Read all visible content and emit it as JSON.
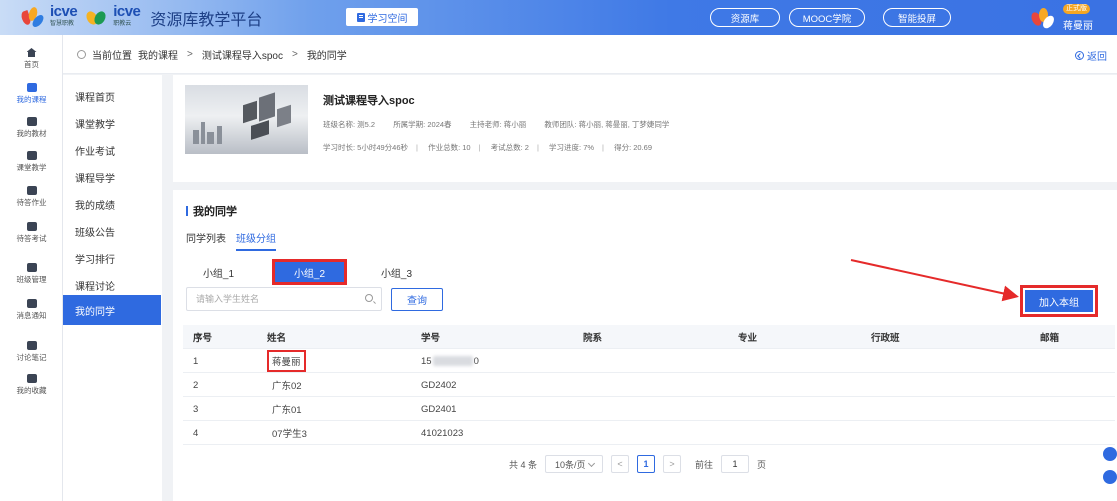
{
  "topbar": {
    "logo1_text": "icve",
    "logo1_sub": "智慧职教",
    "logo2_text": "icve",
    "logo2_sub": "职教云",
    "platform_title": "资源库教学平台",
    "study_space": "学习空间",
    "nav": [
      "资源库",
      "MOOC学院",
      "智能投屏"
    ],
    "user_badge": "正式版",
    "user_name": "蒋曼丽"
  },
  "rail": [
    {
      "label": "首页",
      "icon": "home-icon"
    },
    {
      "label": "我的课程",
      "icon": "course-icon",
      "active": true
    },
    {
      "label": "我的教材",
      "icon": "textbook-icon"
    },
    {
      "label": "课堂教学",
      "icon": "classroom-icon"
    },
    {
      "label": "待答作业",
      "icon": "homework-icon"
    },
    {
      "label": "待答考试",
      "icon": "exam-icon"
    },
    {
      "label": "班级管理",
      "icon": "class-icon"
    },
    {
      "label": "消息通知",
      "icon": "message-icon"
    },
    {
      "label": "讨论笔记",
      "icon": "notes-icon"
    },
    {
      "label": "我的收藏",
      "icon": "favorite-icon"
    }
  ],
  "breadcrumb": {
    "prefix": "当前位置",
    "items": [
      "我的课程",
      "测试课程导入spoc",
      "我的同学"
    ],
    "back": "返回"
  },
  "course_menu": {
    "items": [
      "课程首页",
      "课堂教学",
      "作业考试",
      "课程导学",
      "我的成绩",
      "班级公告",
      "学习排行",
      "课程讨论",
      "我的同学"
    ],
    "active_index": 8
  },
  "course": {
    "title": "测试课程导入spoc",
    "class_name": "班级名称: 测5.2",
    "term": "所属学期: 2024春",
    "teacher": "主持老师: 蒋小丽",
    "team": "教师团队: 蒋小丽, 蒋曼丽, 丁梦婕同学",
    "study_time": "学习时长: 5小时49分46秒",
    "homework_total": "作业总数: 10",
    "exam_total": "考试总数: 2",
    "progress": "学习进度: 7%",
    "score": "得分: 20.69"
  },
  "classmates": {
    "title": "我的同学",
    "tabs": [
      "同学列表",
      "班级分组"
    ],
    "groups": [
      "小组_1",
      "小组_2",
      "小组_3"
    ],
    "active_group": 1,
    "search_placeholder": "请输入学生姓名",
    "query_button": "查询",
    "join_button": "加入本组",
    "columns": [
      "序号",
      "姓名",
      "学号",
      "院系",
      "专业",
      "行政班",
      "邮箱"
    ],
    "rows": [
      {
        "no": "1",
        "name": "蒋曼丽",
        "id_prefix": "15",
        "id_suffix": "0",
        "dept": "",
        "major": "",
        "class": "",
        "email": ""
      },
      {
        "no": "2",
        "name": "广东02",
        "id": "GD2402",
        "dept": "",
        "major": "",
        "class": "",
        "email": ""
      },
      {
        "no": "3",
        "name": "广东01",
        "id": "GD2401",
        "dept": "",
        "major": "",
        "class": "",
        "email": ""
      },
      {
        "no": "4",
        "name": "07学生3",
        "id": "41021023",
        "dept": "",
        "major": "",
        "class": "",
        "email": ""
      }
    ],
    "pagination": {
      "total": "共 4 条",
      "page_size": "10条/页",
      "current": "1",
      "goto_prefix": "前往",
      "goto_value": "1",
      "goto_suffix": "页"
    }
  },
  "colors": {
    "primary": "#2f6ae0",
    "highlight": "#e52a2a"
  }
}
